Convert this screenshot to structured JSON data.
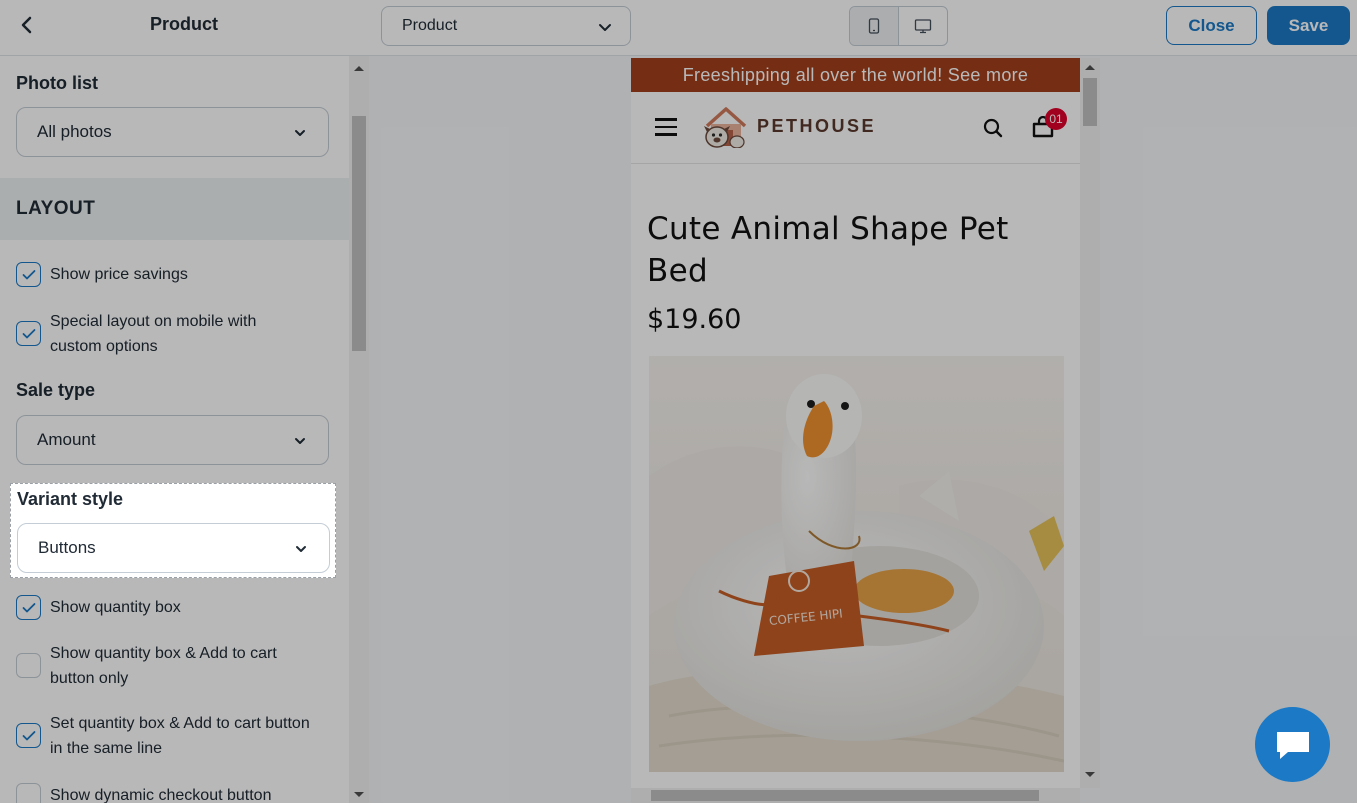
{
  "topbar": {
    "title": "Product",
    "page_select_value": "Product",
    "close_label": "Close",
    "save_label": "Save"
  },
  "sidebar": {
    "photo_list": {
      "label": "Photo list",
      "value": "All photos"
    },
    "layout_heading": "LAYOUT",
    "show_price_savings": {
      "label": "Show price savings",
      "checked": true
    },
    "special_layout": {
      "label": "Special layout on mobile with custom options",
      "checked": true
    },
    "sale_type": {
      "label": "Sale type",
      "value": "Amount"
    },
    "variant_style": {
      "label": "Variant style",
      "value": "Buttons"
    },
    "show_quantity_box": {
      "label": "Show quantity box",
      "checked": true
    },
    "quantity_add_to_cart_only": {
      "label": "Show quantity box & Add to cart button only",
      "checked": false
    },
    "same_line": {
      "label": "Set quantity box & Add to cart button in the same line",
      "checked": true
    },
    "dynamic_checkout": {
      "label": "Show dynamic checkout button",
      "checked": false
    }
  },
  "preview": {
    "promo_text": "Freeshipping all over the world! See more",
    "logo_text": "PETHOUSE",
    "cart_count": "01",
    "product_title": "Cute Animal Shape Pet Bed",
    "product_price": "$19.60",
    "apron_text": "COFFEE HIPI"
  },
  "colors": {
    "accent": "#1b79c5",
    "promo_bar": "#a3401d",
    "cart_badge": "#e0002a"
  },
  "icons": [
    "back-arrow-icon",
    "chevron-down-icon",
    "mobile-icon",
    "desktop-icon",
    "checkmark-icon",
    "hamburger-icon",
    "search-icon",
    "cart-icon",
    "chat-icon"
  ]
}
